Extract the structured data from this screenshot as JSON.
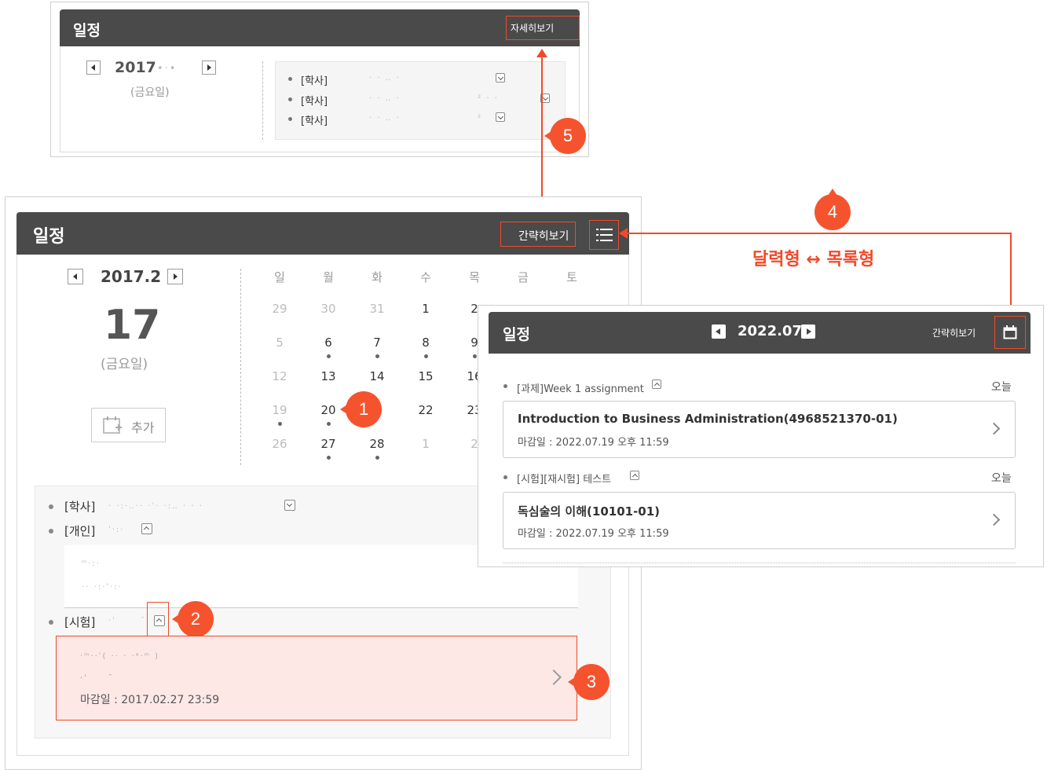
{
  "top_panel": {
    "title": "일정",
    "detail_link": "자세히보기",
    "year": "2017",
    "weekday": "(금요일)",
    "items": [
      {
        "label": "[학사]"
      },
      {
        "label": "[학사]"
      },
      {
        "label": "[학사]"
      }
    ]
  },
  "main_panel": {
    "title": "일정",
    "brief_link": "간략히보기",
    "month": "2017.2",
    "day": "17",
    "weekday": "(금요일)",
    "add_label": "추가",
    "weekdays": [
      "일",
      "월",
      "화",
      "수",
      "목",
      "금",
      "토"
    ],
    "calendar_rows": [
      [
        "29",
        "30",
        "31",
        "1",
        "2"
      ],
      [
        "5",
        "6",
        "7",
        "8",
        "9"
      ],
      [
        "12",
        "13",
        "14",
        "15",
        "16"
      ],
      [
        "19",
        "20",
        "",
        "22",
        "23"
      ],
      [
        "26",
        "27",
        "28",
        "1",
        "2"
      ]
    ],
    "events": [
      {
        "label": "[학사]"
      },
      {
        "label": "[개인]"
      },
      {
        "label": "[시험]"
      }
    ],
    "exam_deadline": "마감일 : 2017.02.27 23:59"
  },
  "list_panel": {
    "title": "일정",
    "month": "2022.07",
    "brief_link": "간략히보기",
    "items": [
      {
        "tag": "[과제]Week 1 assignment",
        "today": "오늘",
        "course": "Introduction to Business Administration(4968521370-01)",
        "deadline": "마감일 : 2022.07.19 오후 11:59"
      },
      {
        "tag": "[시험][재시험] 테스트",
        "today": "오늘",
        "course": "독심술의 이해(10101-01)",
        "deadline": "마감일 : 2022.07.19 오후 11:59"
      }
    ]
  },
  "annotations": {
    "badges": [
      "1",
      "2",
      "3",
      "4",
      "5"
    ],
    "toggle_caption": "달력형 ↔ 목록형"
  },
  "colors": {
    "accent": "#f04a2a",
    "header": "#4a4a4a",
    "highlight": "#fde8e6"
  }
}
